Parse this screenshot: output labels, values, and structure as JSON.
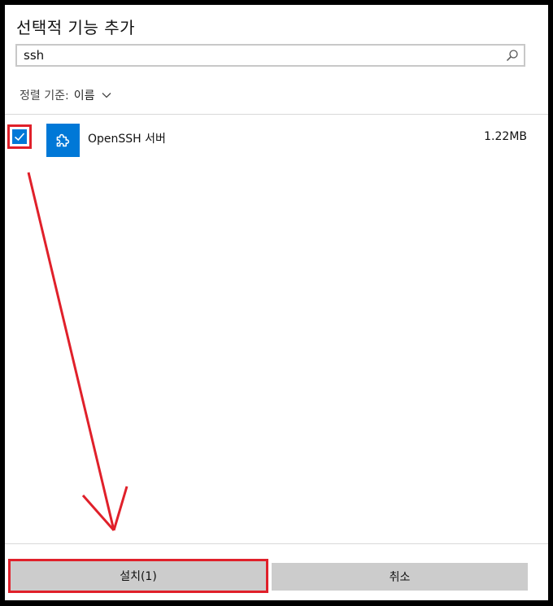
{
  "dialog": {
    "title": "선택적 기능 추가",
    "search": {
      "value": "ssh",
      "placeholder": ""
    },
    "sort": {
      "label": "정렬 기준:",
      "value": "이름"
    },
    "features": [
      {
        "name": "OpenSSH 서버",
        "size": "1.22MB",
        "checked": true
      }
    ],
    "buttons": {
      "install": "설치(1)",
      "cancel": "취소"
    }
  },
  "colors": {
    "accent": "#0078d7",
    "annotation": "#e0202a",
    "button": "#cccccc"
  },
  "icons": [
    "search-icon",
    "chevron-down-icon",
    "checkmark-icon",
    "puzzle-piece-icon"
  ]
}
